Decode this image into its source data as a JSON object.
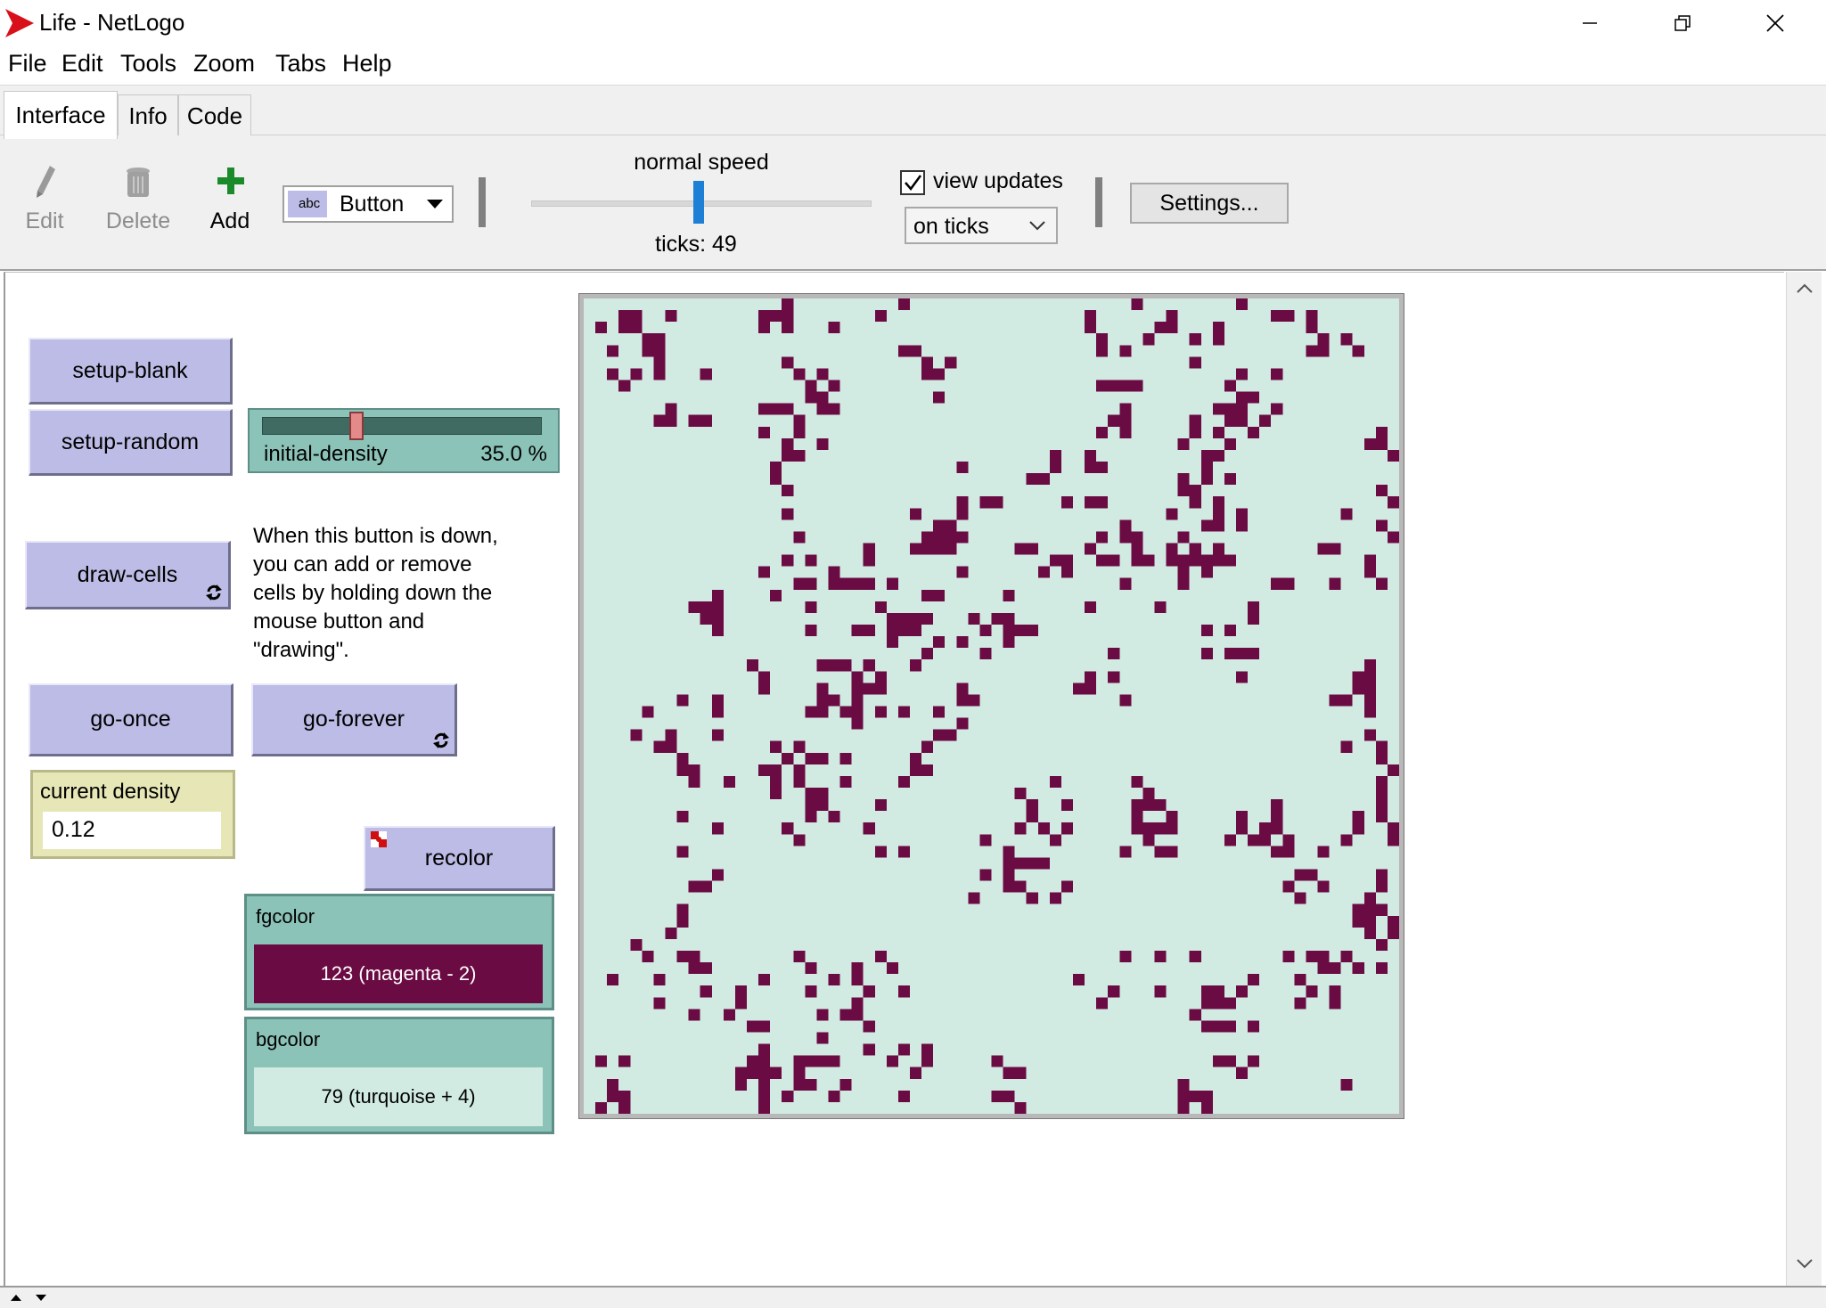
{
  "window": {
    "title": "Life - NetLogo",
    "controls": [
      "minimize",
      "restore",
      "close"
    ]
  },
  "menu": [
    "File",
    "Edit",
    "Tools",
    "Zoom",
    "Tabs",
    "Help"
  ],
  "tabs": [
    {
      "label": "Interface",
      "active": true
    },
    {
      "label": "Info",
      "active": false
    },
    {
      "label": "Code",
      "active": false
    }
  ],
  "toolbar": {
    "edit_label": "Edit",
    "delete_label": "Delete",
    "add_label": "Add",
    "widget_type": "Button",
    "widget_type_icon": "abc",
    "speed_label": "normal speed",
    "speed_fraction": 0.5,
    "ticks_label": "ticks: 49",
    "view_updates_label": "view updates",
    "view_updates_checked": true,
    "update_mode": "on ticks",
    "settings_label": "Settings..."
  },
  "widgets": {
    "setup_blank": "setup-blank",
    "setup_random": "setup-random",
    "slider": {
      "name": "initial-density",
      "value": "35.0 %",
      "fraction": 0.35
    },
    "draw_cells": "draw-cells",
    "note": "When this button is down, you can add or remove cells by holding down the mouse button and \"drawing\".",
    "go_once": "go-once",
    "go_forever": "go-forever",
    "monitor": {
      "label": "current density",
      "value": "0.12"
    },
    "recolor": "recolor",
    "fgcolor": {
      "label": "fgcolor",
      "value": "123 (magenta - 2)",
      "color": "#6b0b43"
    },
    "bgcolor": {
      "label": "bgcolor",
      "value": "79 (turquoise + 4)",
      "color": "#d2ebe2"
    }
  },
  "world": {
    "grid_size": 70,
    "cell_color": "#6b0b43",
    "background_color": "#d2ebe2"
  },
  "colors": {
    "button": "#bcbce6",
    "slider": "#8cc3b8",
    "monitor": "#e6e6b6",
    "speed_thumb": "#1e7fd6",
    "add_icon": "#1a8a2a"
  }
}
